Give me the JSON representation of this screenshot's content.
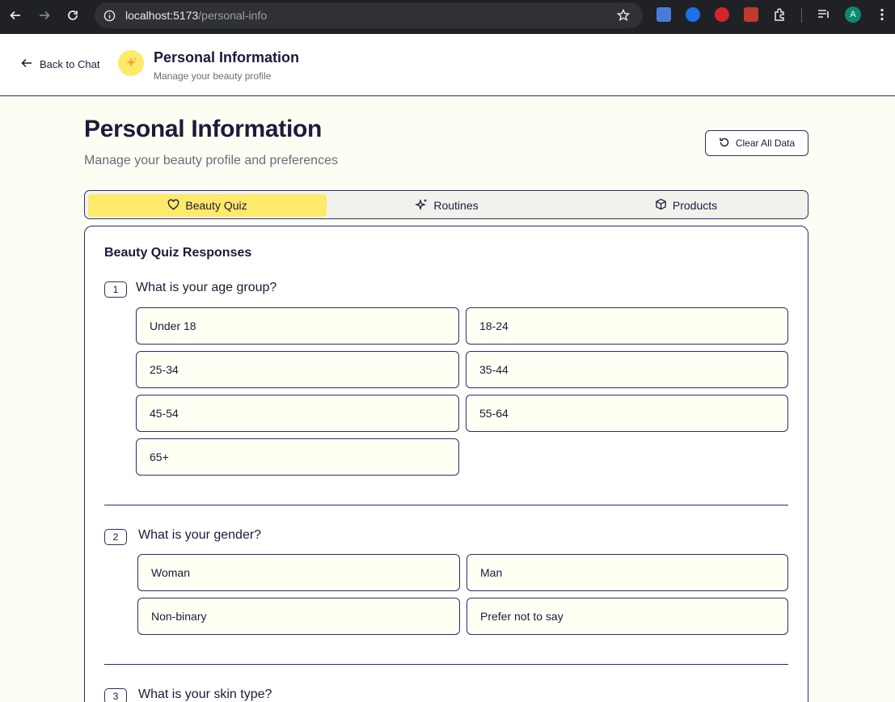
{
  "browser": {
    "url_host": "localhost:5173",
    "url_path": "/personal-info",
    "avatar_letter": "A",
    "colors": {
      "chrome": "#202124",
      "omnibox": "#303134"
    }
  },
  "header": {
    "back_label": "Back to Chat",
    "title": "Personal Information",
    "subtitle": "Manage your beauty profile",
    "logo_icon": "sparkle-icon"
  },
  "page": {
    "title": "Personal Information",
    "subtitle": "Manage your beauty profile and preferences",
    "clear_label": "Clear All Data"
  },
  "tabs": [
    {
      "label": "Beauty Quiz",
      "icon": "heart-icon",
      "active": true
    },
    {
      "label": "Routines",
      "icon": "sparkles-icon",
      "active": false
    },
    {
      "label": "Products",
      "icon": "box-icon",
      "active": false
    }
  ],
  "quiz": {
    "title": "Beauty Quiz Responses",
    "questions": [
      {
        "number": "1",
        "text": "What is your age group?",
        "options": [
          "Under 18",
          "18-24",
          "25-34",
          "35-44",
          "45-54",
          "55-64",
          "65+"
        ]
      },
      {
        "number": "2",
        "text": "What is your gender?",
        "options": [
          "Woman",
          "Man",
          "Non-binary",
          "Prefer not to say"
        ]
      },
      {
        "number": "3",
        "text": "What is your skin type?",
        "options": []
      }
    ]
  },
  "colors": {
    "accent": "#fde96a",
    "border": "#2b2f6e",
    "text": "#1b1b3a",
    "option_bg": "#fffff3",
    "page_bg": "#fdfdf3"
  }
}
